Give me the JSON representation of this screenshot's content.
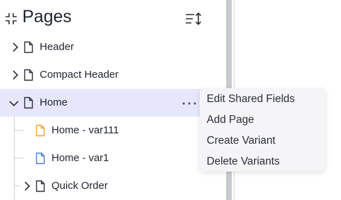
{
  "panel": {
    "title": "Pages",
    "icons": {
      "collapse": "collapse-icon",
      "sort": "sort-icon"
    }
  },
  "tree": [
    {
      "label": "Header",
      "expanded": false,
      "icon_color": "#2a2e38"
    },
    {
      "label": "Compact Header",
      "expanded": false,
      "icon_color": "#2a2e38"
    },
    {
      "label": "Home",
      "expanded": true,
      "selected": true,
      "icon_color": "#2a2e38"
    },
    {
      "label": "Home - var111",
      "icon_color": "#f0a030"
    },
    {
      "label": "Home - var1",
      "icon_color": "#4a7bd8"
    },
    {
      "label": "Quick Order",
      "expanded": false,
      "icon_color": "#2a2e38"
    }
  ],
  "context_menu": {
    "items": [
      "Edit Shared Fields",
      "Add Page",
      "Create Variant",
      "Delete Variants"
    ]
  },
  "colors": {
    "selected_row": "#e6e7fb",
    "accent": "#4a7bd8",
    "variant_warn": "#f0a030"
  }
}
